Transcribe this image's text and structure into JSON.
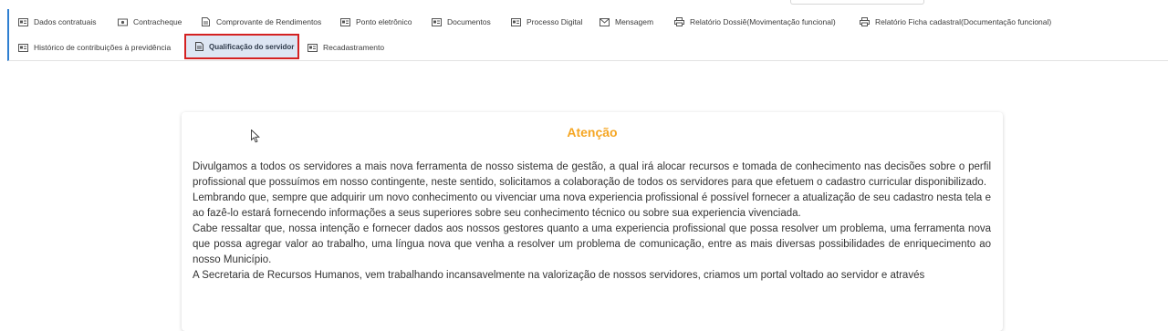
{
  "tabs": [
    {
      "label": "Dados contratuais",
      "icon": "id-card-icon"
    },
    {
      "label": "Contracheque",
      "icon": "money-icon"
    },
    {
      "label": "Comprovante de Rendimentos",
      "icon": "document-icon"
    },
    {
      "label": "Ponto eletrônico",
      "icon": "id-card-icon"
    },
    {
      "label": "Documentos",
      "icon": "id-card-icon"
    },
    {
      "label": "Processo Digital",
      "icon": "id-card-icon"
    },
    {
      "label": "Mensagem",
      "icon": "envelope-icon"
    },
    {
      "label": "Relatório Dossiê(Movimentação funcional)",
      "icon": "printer-icon"
    },
    {
      "label": "Relatório Ficha cadastral(Documentação funcional)",
      "icon": "printer-icon"
    },
    {
      "label": "Histórico de contribuições à previdência",
      "icon": "id-card-icon"
    },
    {
      "label": "Qualificação do servidor",
      "icon": "document-icon",
      "active": true
    },
    {
      "label": "Recadastramento",
      "icon": "id-card-icon"
    }
  ],
  "notice": {
    "title": "Atenção",
    "paragraphs": [
      "Divulgamos a todos os servidores a mais nova ferramenta de nosso sistema de gestão, a qual irá alocar recursos e tomada de conhecimento nas decisões sobre o perfil profissional que possuímos em nosso contingente, neste sentido, solicitamos a colaboração de todos os servidores para que efetuem o cadastro curricular disponibilizado.",
      "Lembrando que, sempre que adquirir um novo conhecimento ou vivenciar uma nova experiencia profissional é possível fornecer a atualização de seu cadastro nesta tela e ao fazê-lo estará fornecendo informações a seus superiores sobre seu conhecimento técnico ou sobre sua experiencia vivenciada.",
      "Cabe ressaltar que, nossa intenção e fornecer dados aos nossos gestores quanto a uma experiencia profissional que possa resolver um problema, uma ferramenta nova que possa agregar valor ao trabalho, uma língua nova que venha a resolver um problema de comunicação, entre as mais diversas possibilidades de enriquecimento ao nosso Município.",
      "A Secretaria de Recursos Humanos, vem trabalhando incansavelmente na valorização de nossos servidores, criamos um portal voltado ao servidor e através"
    ]
  },
  "colors": {
    "accent_border": "#2f7fd1",
    "active_outline": "#d42121",
    "active_bg": "#dde6f3",
    "title": "#f5a623"
  }
}
